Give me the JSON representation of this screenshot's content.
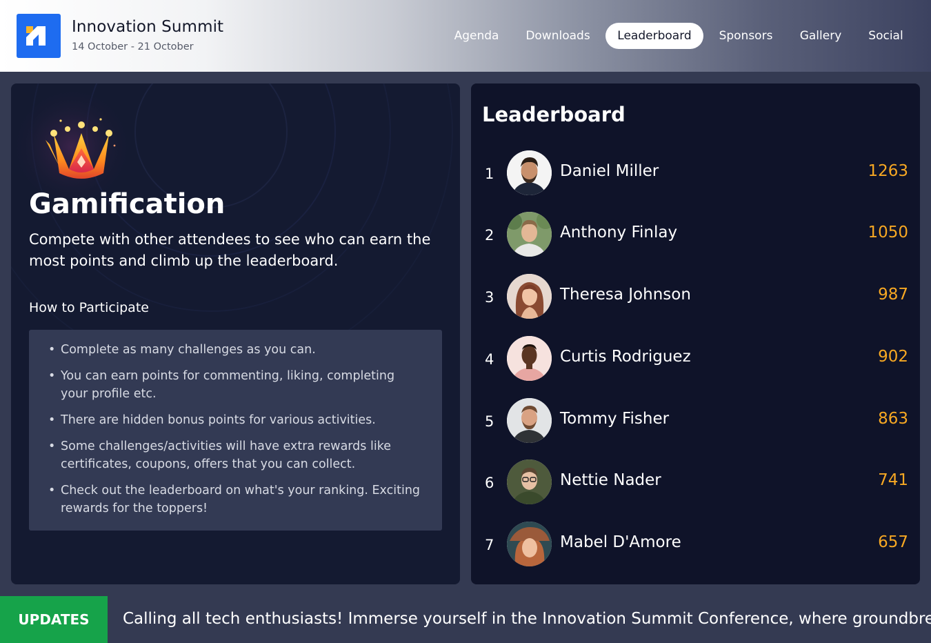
{
  "header": {
    "brand_title": "Innovation Summit",
    "brand_dates": "14 October - 21 October",
    "nav": [
      {
        "label": "Agenda"
      },
      {
        "label": "Downloads"
      },
      {
        "label": "Leaderboard",
        "active": true
      },
      {
        "label": "Sponsors"
      },
      {
        "label": "Gallery"
      },
      {
        "label": "Social"
      }
    ]
  },
  "gamification": {
    "icon": "crown-icon",
    "title": "Gamification",
    "description": "Compete with other attendees to see who can earn the most points and climb up the leaderboard.",
    "howto_heading": "How to Participate",
    "rules": [
      "Complete as many challenges as you can.",
      "You can earn points for commenting, liking, completing your profile etc.",
      "There are hidden bonus points for various activities.",
      "Some challenges/activities will have extra rewards like certificates, coupons, offers that you can collect.",
      "Check out the leaderboard on what's your ranking. Exciting rewards for the toppers!"
    ]
  },
  "leaderboard": {
    "title": "Leaderboard",
    "entries": [
      {
        "rank": "1",
        "name": "Daniel Miller",
        "score": "1263"
      },
      {
        "rank": "2",
        "name": "Anthony Finlay",
        "score": "1050"
      },
      {
        "rank": "3",
        "name": "Theresa Johnson",
        "score": "987"
      },
      {
        "rank": "4",
        "name": "Curtis Rodriguez",
        "score": "902"
      },
      {
        "rank": "5",
        "name": "Tommy Fisher",
        "score": "863"
      },
      {
        "rank": "6",
        "name": "Nettie Nader",
        "score": "741"
      },
      {
        "rank": "7",
        "name": "Mabel D'Amore",
        "score": "657"
      }
    ]
  },
  "ticker": {
    "badge": "UPDATES",
    "text": "Calling all tech enthusiasts! Immerse yourself in the Innovation Summit Conference, where groundbreaking"
  },
  "colors": {
    "brand_blue": "#1e6cf0",
    "score_orange": "#f7a823",
    "updates_green": "#16a34a",
    "card_dark": "#0f1329"
  }
}
